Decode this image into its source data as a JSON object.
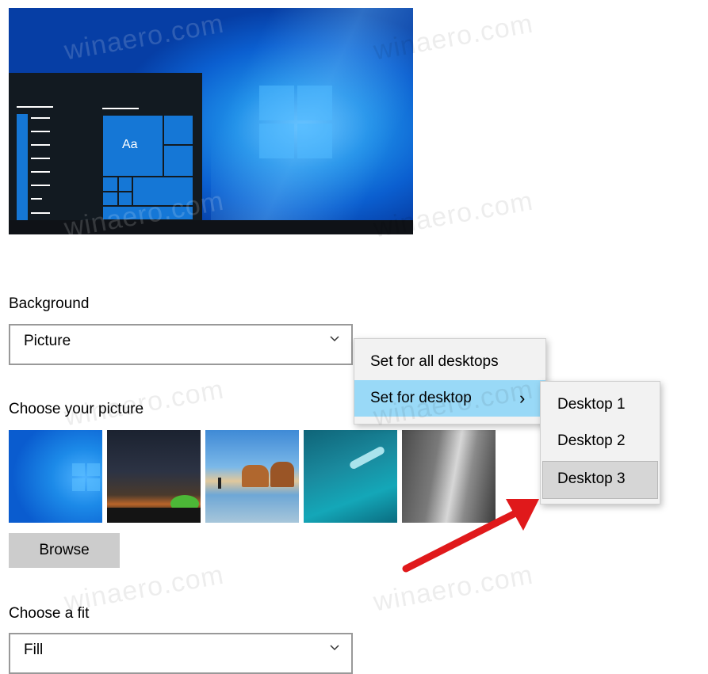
{
  "background_section": {
    "label": "Background",
    "selected": "Picture"
  },
  "picture_section": {
    "label": "Choose your picture"
  },
  "browse_button": {
    "label": "Browse"
  },
  "fit_section": {
    "label": "Choose a fit",
    "selected": "Fill"
  },
  "context_menu": {
    "items": [
      {
        "label": "Set for all desktops"
      },
      {
        "label": "Set for desktop",
        "submenu_glyph": "›"
      }
    ]
  },
  "submenu": {
    "items": [
      {
        "label": "Desktop 1"
      },
      {
        "label": "Desktop 2"
      },
      {
        "label": "Desktop 3"
      }
    ]
  },
  "preview": {
    "sample_text": "Aa"
  },
  "watermark": {
    "text": "winaero.com"
  },
  "colors": {
    "menu_highlight": "#99d9f7",
    "submenu_selected": "#d6d6d6",
    "arrow": "#e0191b",
    "accent": "#1577d6"
  },
  "icons": {
    "dropdown": "chevron-down-icon",
    "submenu": "chevron-right-icon",
    "annotation": "red-arrow-icon"
  }
}
